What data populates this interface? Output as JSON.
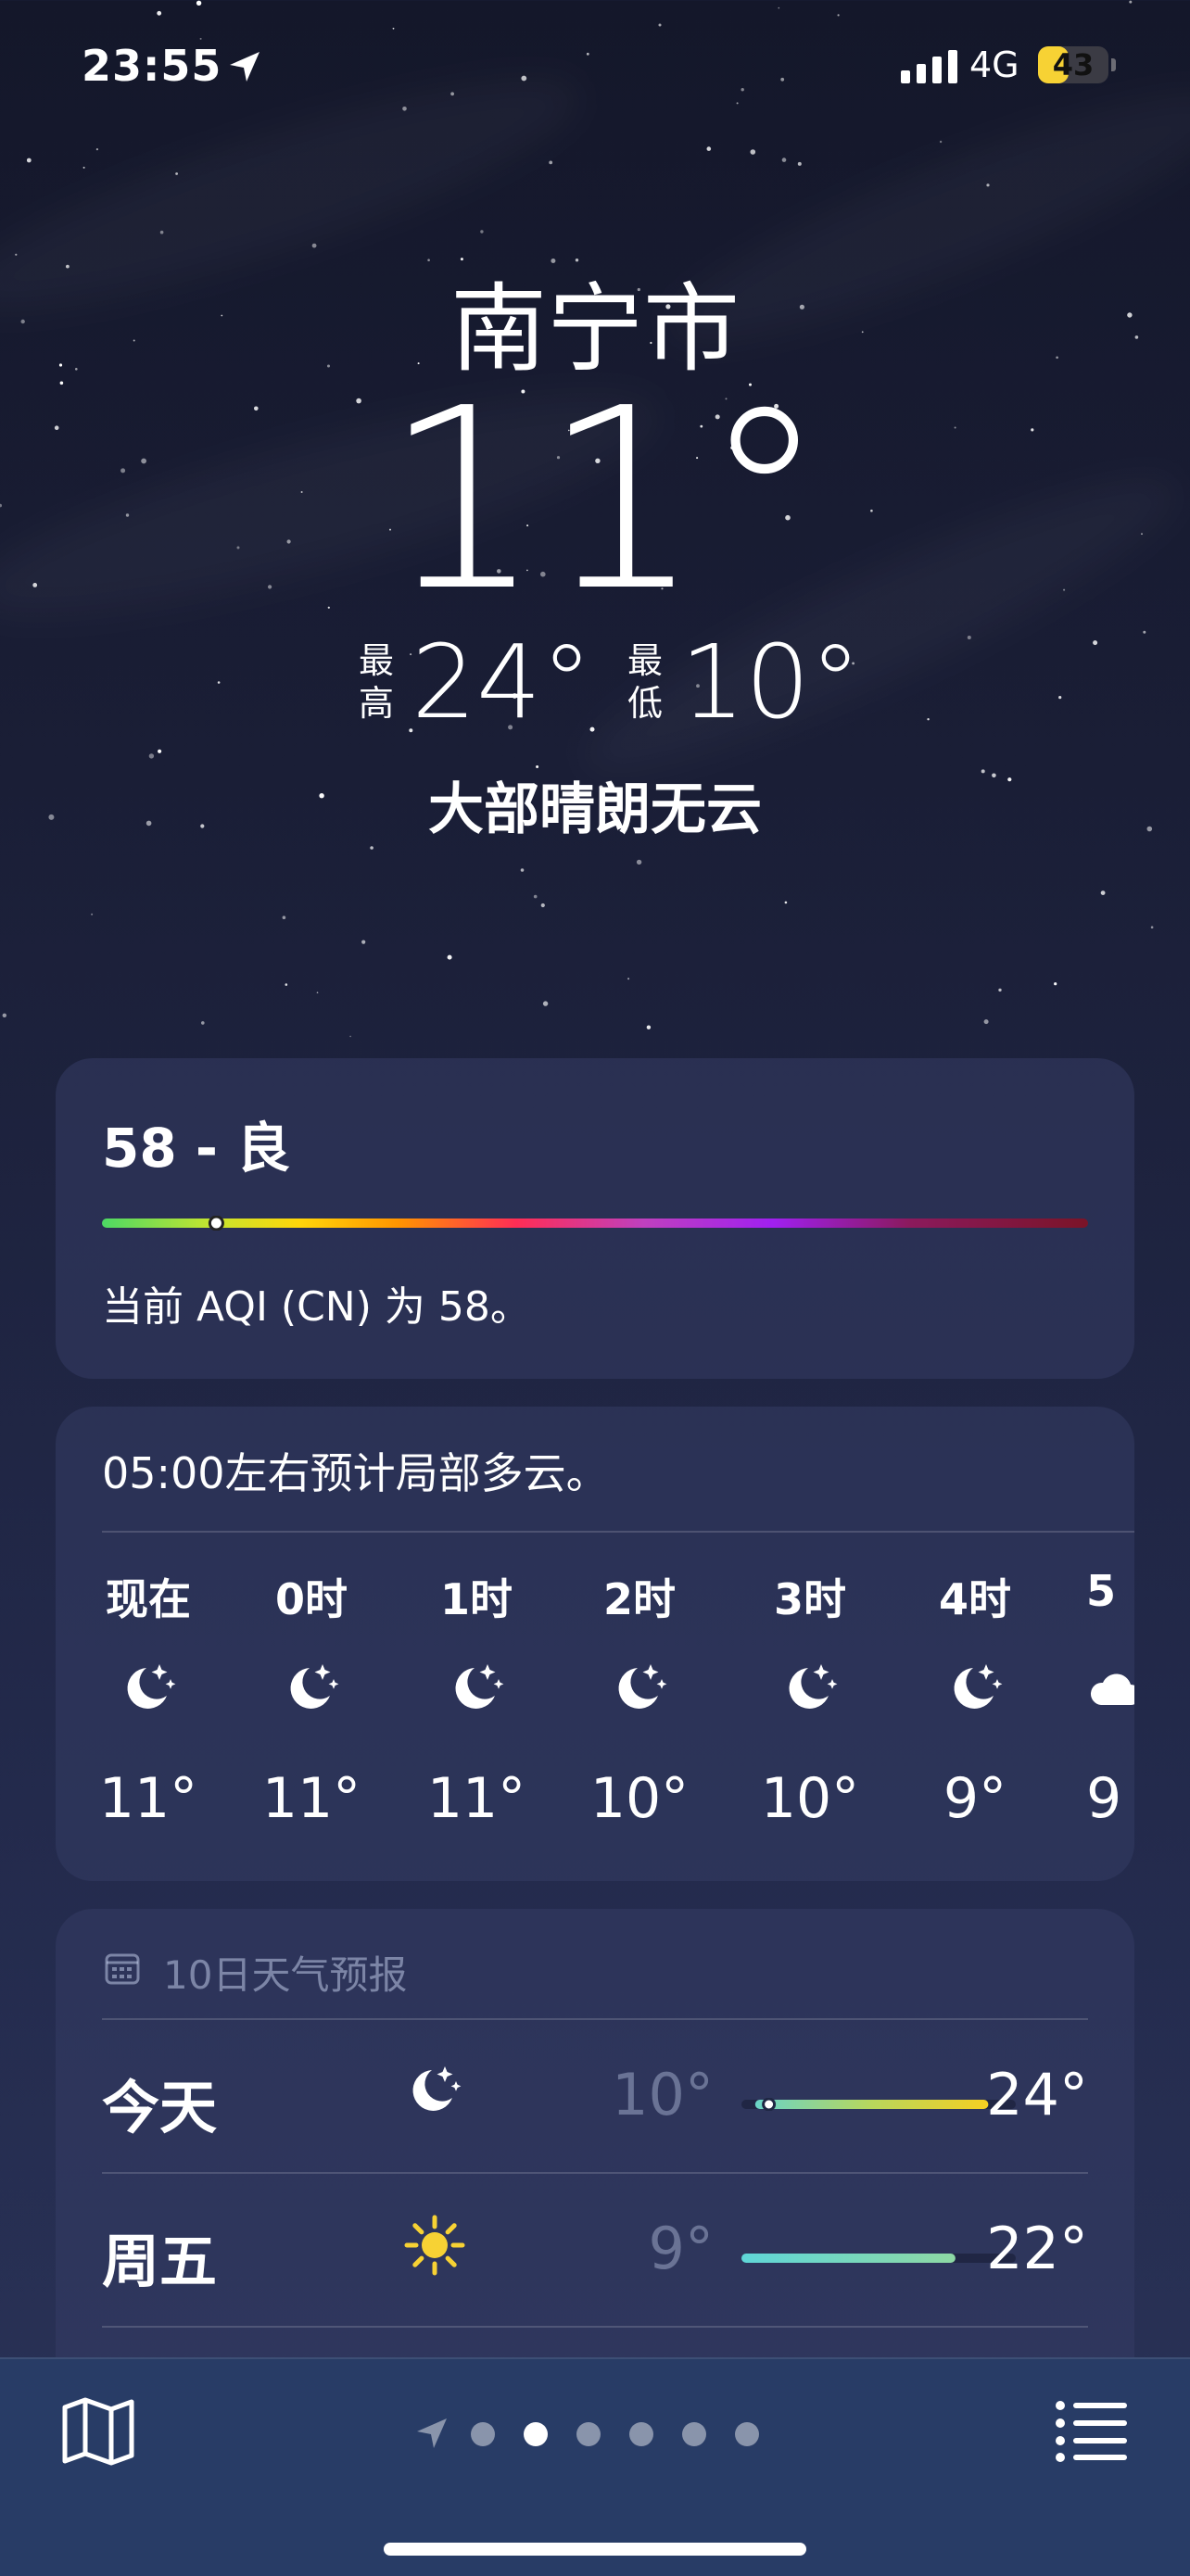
{
  "status": {
    "time": "23:55",
    "network": "4G",
    "battery": "43",
    "battery_percent": 43
  },
  "location": {
    "city": "南宁市",
    "temperature": "11°",
    "high_label_top": "最",
    "high_label_bottom": "高",
    "high": "24°",
    "low_label_top": "最",
    "low_label_bottom": "低",
    "low": "10°",
    "condition": "大部晴朗无云"
  },
  "aqi": {
    "title": "58 - 良",
    "value": 58,
    "max": 500,
    "description": "当前 AQI (CN) 为 58。"
  },
  "hourly": {
    "summary": "05:00左右预计局部多云。",
    "hours": [
      {
        "label": "现在",
        "icon": "moon-stars-icon",
        "temp": "11°"
      },
      {
        "label": "0时",
        "icon": "moon-stars-icon",
        "temp": "11°"
      },
      {
        "label": "1时",
        "icon": "moon-stars-icon",
        "temp": "11°"
      },
      {
        "label": "2时",
        "icon": "moon-stars-icon",
        "temp": "10°"
      },
      {
        "label": "3时",
        "icon": "moon-stars-icon",
        "temp": "10°"
      },
      {
        "label": "4时",
        "icon": "moon-stars-icon",
        "temp": "9°"
      },
      {
        "label": "5",
        "icon": "cloud-icon",
        "temp": "9"
      }
    ]
  },
  "daily": {
    "title": "10日天气预报",
    "days": [
      {
        "name": "今天",
        "icon": "moon-stars-icon",
        "low": "10°",
        "high": "24°",
        "range_start": 0.05,
        "range_end": 0.9,
        "current_marker": 0.1,
        "gradient": [
          "#69d4c8",
          "#b8d65c",
          "#f5cf22"
        ]
      },
      {
        "name": "周五",
        "icon": "sun-icon",
        "low": "9°",
        "high": "22°",
        "range_start": 0.0,
        "range_end": 0.78,
        "gradient": [
          "#5fd6d8",
          "#8ed9a4"
        ]
      }
    ]
  },
  "tabbar": {
    "map_icon": "map-icon",
    "list_icon": "list-icon",
    "page_count": 6,
    "active_page": 1
  },
  "colors": {
    "aqi_gradient": [
      "#4cd964",
      "#c5e52f",
      "#ffd60a",
      "#ff9500",
      "#ff2d55",
      "#bf40bf",
      "#a020f0",
      "#8b1a5c",
      "#7a1428"
    ],
    "battery": "#f7d234"
  }
}
